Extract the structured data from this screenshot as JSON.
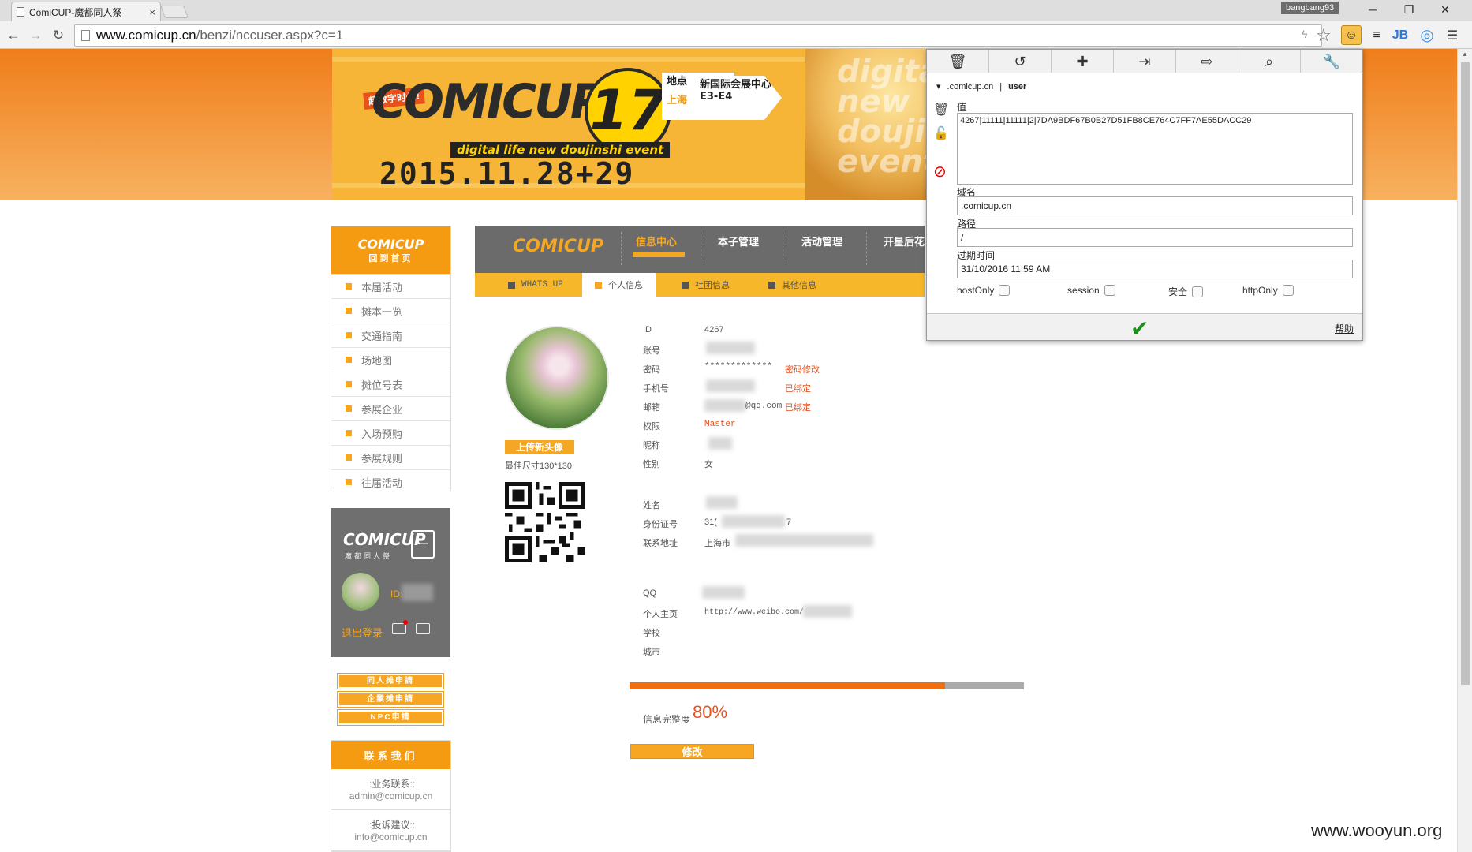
{
  "browser": {
    "tab_title": "ComiCUP-魔都同人祭",
    "tab_close": "×",
    "profile_name": "bangbang93",
    "url_host": "www.comicup.cn",
    "url_path": "/benzi/nccuser.aspx?c=1",
    "ext_jb": "JB"
  },
  "banner": {
    "tag": "超数字时代!",
    "logo": "COMICUP",
    "number": "17",
    "subtitle": "digital life  new doujinshi event",
    "date": "2015.11.28+29",
    "location_label": "地点",
    "city": "上海",
    "venue": "新国际会展中心E3-E4",
    "ghost": "digita new doujinshi event"
  },
  "left_nav": {
    "logo": "COMICUP",
    "home_label": "回到首页",
    "items": [
      "本届活动",
      "摊本一览",
      "交通指南",
      "场地图",
      "摊位号表",
      "参展企业",
      "入场预购",
      "参展规则",
      "往届活动"
    ]
  },
  "mini_profile": {
    "logo": "COMICUP",
    "logo_sub": "魔都同人祭",
    "id_label": "ID:",
    "logout": "退出登录"
  },
  "apply_buttons": [
    "同人摊申請",
    "企業摊申請",
    "NPC申請"
  ],
  "contact": {
    "title": "联系我们",
    "business_label": "::业务联系::",
    "business_email": "admin@comicup.cn",
    "complaint_label": "::投诉建议::",
    "complaint_email": "info@comicup.cn"
  },
  "main_nav": {
    "logo": "COMICUP",
    "items": [
      "信息中心",
      "本子管理",
      "活动管理",
      "开星后花"
    ]
  },
  "sub_nav": {
    "items": [
      "WHATS UP",
      "个人信息",
      "社团信息",
      "其他信息"
    ]
  },
  "profile": {
    "upload_label": "上传新头像",
    "best_size": "最佳尺寸130*130",
    "fields": [
      {
        "label": "ID",
        "value": "4267"
      },
      {
        "label": "账号",
        "value": ""
      },
      {
        "label": "密码",
        "value": "*************",
        "link": "密码修改"
      },
      {
        "label": "手机号",
        "value": "",
        "link": "已绑定"
      },
      {
        "label": "邮箱",
        "value": "@qq.com",
        "link": "已绑定"
      },
      {
        "label": "权限",
        "value": "Master"
      },
      {
        "label": "昵称",
        "value": ""
      },
      {
        "label": "性别",
        "value": "女"
      },
      {
        "label": "姓名",
        "value": ""
      },
      {
        "label": "身份证号",
        "value": "31(",
        "tail": "7"
      },
      {
        "label": "联系地址",
        "value": "上海市"
      },
      {
        "label": "QQ",
        "value": ""
      },
      {
        "label": "个人主页",
        "value": "http://www.weibo.com/"
      },
      {
        "label": "学校",
        "value": ""
      },
      {
        "label": "城市",
        "value": ""
      }
    ],
    "completeness_label": "信息完整度",
    "completeness_value": "80%",
    "completeness_fraction": 0.8,
    "edit_label": "修改"
  },
  "cookie_editor": {
    "domain": ".comicup.cn",
    "name": "user",
    "value_label": "值",
    "value": "4267|11111|11111|2|7DA9BDF67B0B27D51FB8CE764C7FF7AE55DACC29",
    "domain_label": "域名",
    "domain_value": ".comicup.cn",
    "path_label": "路径",
    "path_value": "/",
    "expiry_label": "过期时间",
    "expiry_value": "31/10/2016 11:59 AM",
    "flags": [
      "hostOnly",
      "session",
      "安全",
      "httpOnly"
    ],
    "help": "帮助"
  },
  "watermark": "www.wooyun.org",
  "colors": {
    "brand_orange": "#f5a623",
    "banner_orange": "#f07d1a",
    "nav_gray": "#6b6b6b",
    "link_red": "#e9531d",
    "ok_green": "#1a8f1a"
  }
}
